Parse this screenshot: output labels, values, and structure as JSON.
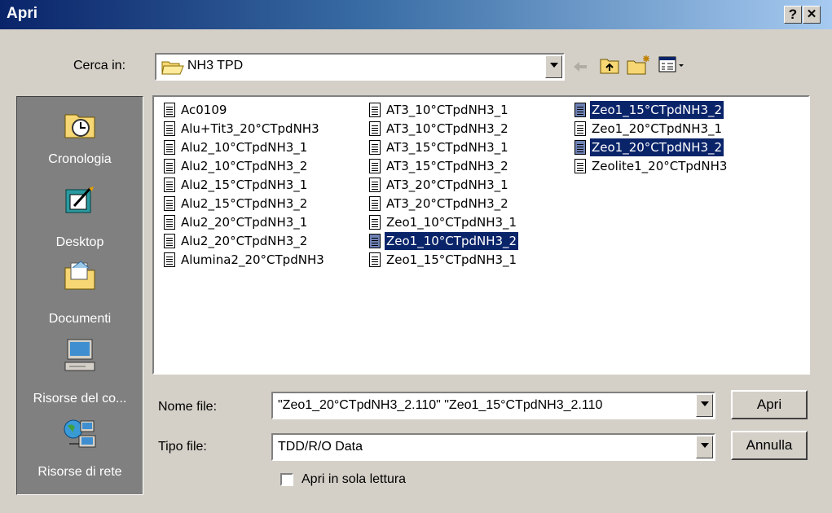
{
  "window": {
    "title": "Apri",
    "help": "?",
    "close": "✕"
  },
  "lookin": {
    "label": "Cerca in:",
    "value": "NH3 TPD"
  },
  "places": [
    {
      "label": "Cronologia",
      "icon": "history-icon"
    },
    {
      "label": "Desktop",
      "icon": "desktop-icon"
    },
    {
      "label": "Documenti",
      "icon": "documents-icon"
    },
    {
      "label": "Risorse del co...",
      "icon": "my-computer-icon"
    },
    {
      "label": "Risorse di rete",
      "icon": "network-icon"
    }
  ],
  "files": [
    {
      "name": "Ac0109",
      "selected": false
    },
    {
      "name": "Alu+Tit3_20°CTpdNH3",
      "selected": false
    },
    {
      "name": "Alu2_10°CTpdNH3_1",
      "selected": false
    },
    {
      "name": "Alu2_10°CTpdNH3_2",
      "selected": false
    },
    {
      "name": "Alu2_15°CTpdNH3_1",
      "selected": false
    },
    {
      "name": "Alu2_15°CTpdNH3_2",
      "selected": false
    },
    {
      "name": "Alu2_20°CTpdNH3_1",
      "selected": false
    },
    {
      "name": "Alu2_20°CTpdNH3_2",
      "selected": false
    },
    {
      "name": "Alumina2_20°CTpdNH3",
      "selected": false
    },
    {
      "name": "AT3_10°CTpdNH3_1",
      "selected": false
    },
    {
      "name": "AT3_10°CTpdNH3_2",
      "selected": false
    },
    {
      "name": "AT3_15°CTpdNH3_1",
      "selected": false
    },
    {
      "name": "AT3_15°CTpdNH3_2",
      "selected": false
    },
    {
      "name": "AT3_20°CTpdNH3_1",
      "selected": false
    },
    {
      "name": "AT3_20°CTpdNH3_2",
      "selected": false
    },
    {
      "name": "Zeo1_10°CTpdNH3_1",
      "selected": false
    },
    {
      "name": "Zeo1_10°CTpdNH3_2",
      "selected": true
    },
    {
      "name": "Zeo1_15°CTpdNH3_1",
      "selected": false
    },
    {
      "name": "Zeo1_15°CTpdNH3_2",
      "selected": true
    },
    {
      "name": "Zeo1_20°CTpdNH3_1",
      "selected": false
    },
    {
      "name": "Zeo1_20°CTpdNH3_2",
      "selected": true
    },
    {
      "name": "Zeolite1_20°CTpdNH3",
      "selected": false
    }
  ],
  "filename": {
    "label": "Nome file:",
    "value": "\"Zeo1_20°CTpdNH3_2.110\" \"Zeo1_15°CTpdNH3_2.110"
  },
  "filetype": {
    "label": "Tipo file:",
    "value": "TDD/R/O Data"
  },
  "readonly": {
    "label": "Apri in sola lettura",
    "checked": false
  },
  "buttons": {
    "open": "Apri",
    "cancel": "Annulla"
  },
  "colors": {
    "titlebar": "#0a246a",
    "selection": "#0a246a",
    "dialog": "#d4d0c8"
  }
}
